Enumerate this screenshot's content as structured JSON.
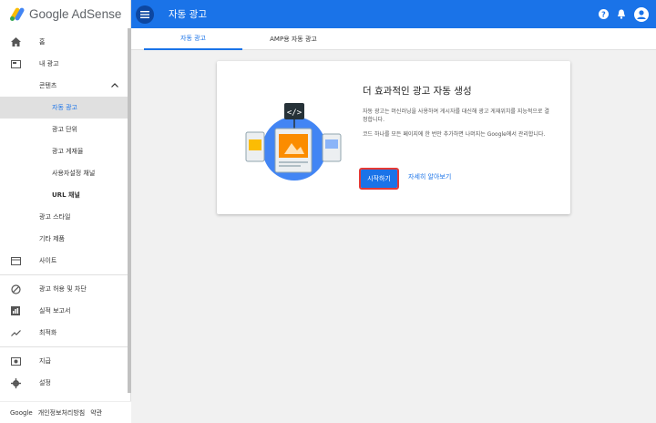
{
  "app": {
    "logo_text": "Google AdSense"
  },
  "header": {
    "title": "자동 광고"
  },
  "tabs": [
    {
      "label": "자동 광고"
    },
    {
      "label": "AMP용 자동 광고"
    }
  ],
  "sidebar": {
    "items": [
      {
        "label": "홈"
      },
      {
        "label": "내 광고"
      },
      {
        "label": "콘텐츠"
      },
      {
        "label": "자동 광고"
      },
      {
        "label": "광고 단위"
      },
      {
        "label": "광고 게재율"
      },
      {
        "label": "사용자설정 채널"
      },
      {
        "label": "URL 채널"
      },
      {
        "label": "광고 스타일"
      },
      {
        "label": "기타 제품"
      },
      {
        "label": "사이트"
      },
      {
        "label": "광고 허용 및 차단"
      },
      {
        "label": "실적 보고서"
      },
      {
        "label": "최적화"
      },
      {
        "label": "지급"
      },
      {
        "label": "설정"
      }
    ],
    "footer": [
      "Google",
      "개인정보처리방침",
      "약관"
    ]
  },
  "card": {
    "title": "더 효과적인 광고 자동 생성",
    "desc1": "자동 광고는 머신러닝을 사용하여 게시자를 대신해 광고 게재위치를 지능적으로 결정합니다.",
    "desc2": "코드 하나를 모든 페이지에 한 번만 추가하면 나머지는 Google에서 관리합니다.",
    "start_label": "시작하기",
    "learn_label": "자세히 알아보기"
  },
  "colors": {
    "primary": "#1a73e8",
    "highlight": "#e53935"
  }
}
